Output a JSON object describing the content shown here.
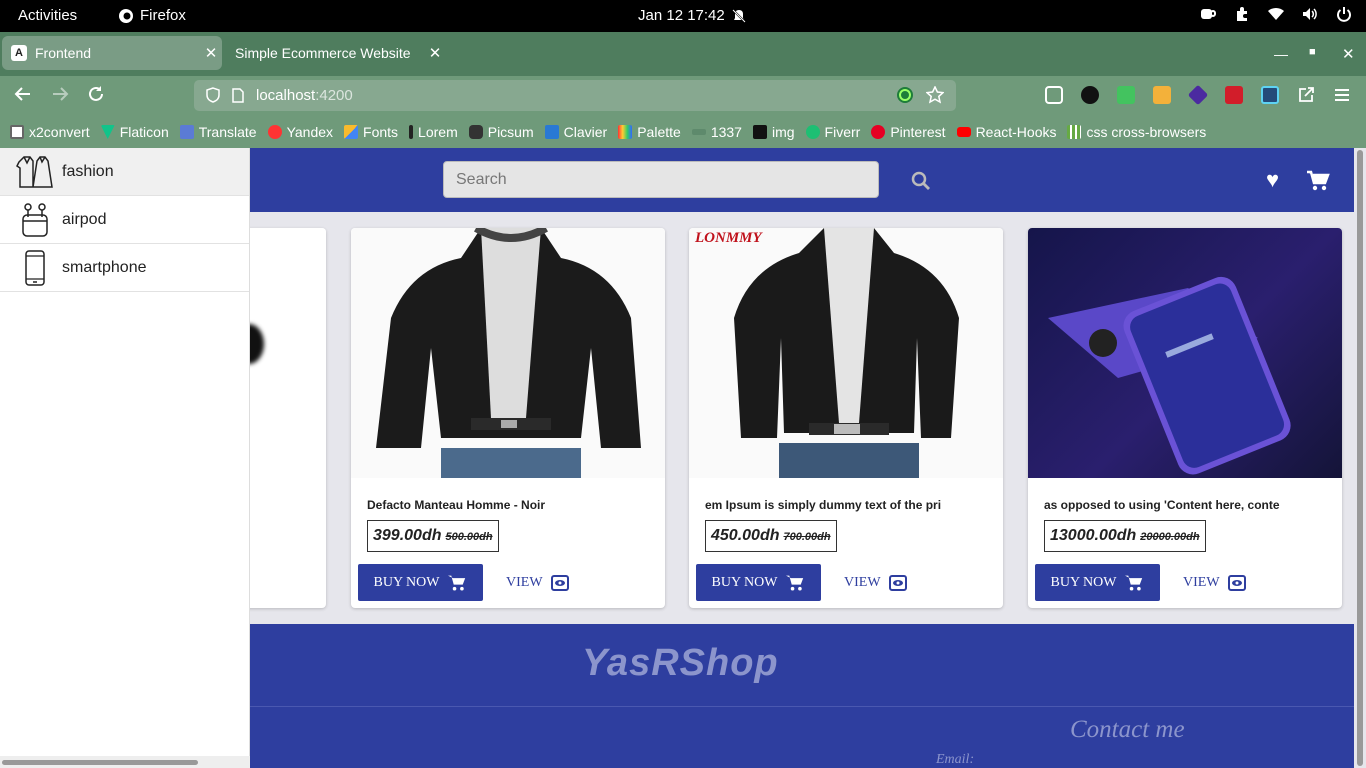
{
  "os": {
    "activities": "Activities",
    "app": "Firefox",
    "clock": "Jan 12  17:42"
  },
  "tabs": [
    {
      "label": "Frontend"
    },
    {
      "label": "Simple Ecommerce Website"
    }
  ],
  "url": {
    "host": "localhost",
    "port": ":4200"
  },
  "bookmarks": [
    "x2convert",
    "Flaticon",
    "Translate",
    "Yandex",
    "Fonts",
    "Lorem",
    "Picsum",
    "Clavier",
    "Palette",
    "1337",
    "img",
    "Fiverr",
    "Pinterest",
    "React-Hooks",
    "css cross-browsers"
  ],
  "header": {
    "search_placeholder": "Search"
  },
  "sidenav": [
    {
      "label": "fashion",
      "icon": "clothes-icon"
    },
    {
      "label": "airpod",
      "icon": "airpod-icon"
    },
    {
      "label": "smartphone",
      "icon": "smartphone-icon"
    }
  ],
  "products": [
    {
      "name": "Defacto Manteau Homme - Noir",
      "price": "399.00dh",
      "old": "500.00dh",
      "buy": "BUY NOW",
      "view": "VIEW"
    },
    {
      "name": "em Ipsum is simply dummy text of the pri",
      "price": "450.00dh",
      "old": "700.00dh",
      "buy": "BUY NOW",
      "view": "VIEW",
      "badge": "LONMMY"
    },
    {
      "name": "as opposed to using 'Content here, conte",
      "price": "13000.00dh",
      "old": "20000.00dh",
      "buy": "BUY NOW",
      "view": "VIEW"
    }
  ],
  "footer": {
    "brand": "YasRShop",
    "contact": "Contact me",
    "email_label": "Email:"
  },
  "colors": {
    "primary": "#2e3e9f",
    "browser": "#6f9a7a"
  }
}
